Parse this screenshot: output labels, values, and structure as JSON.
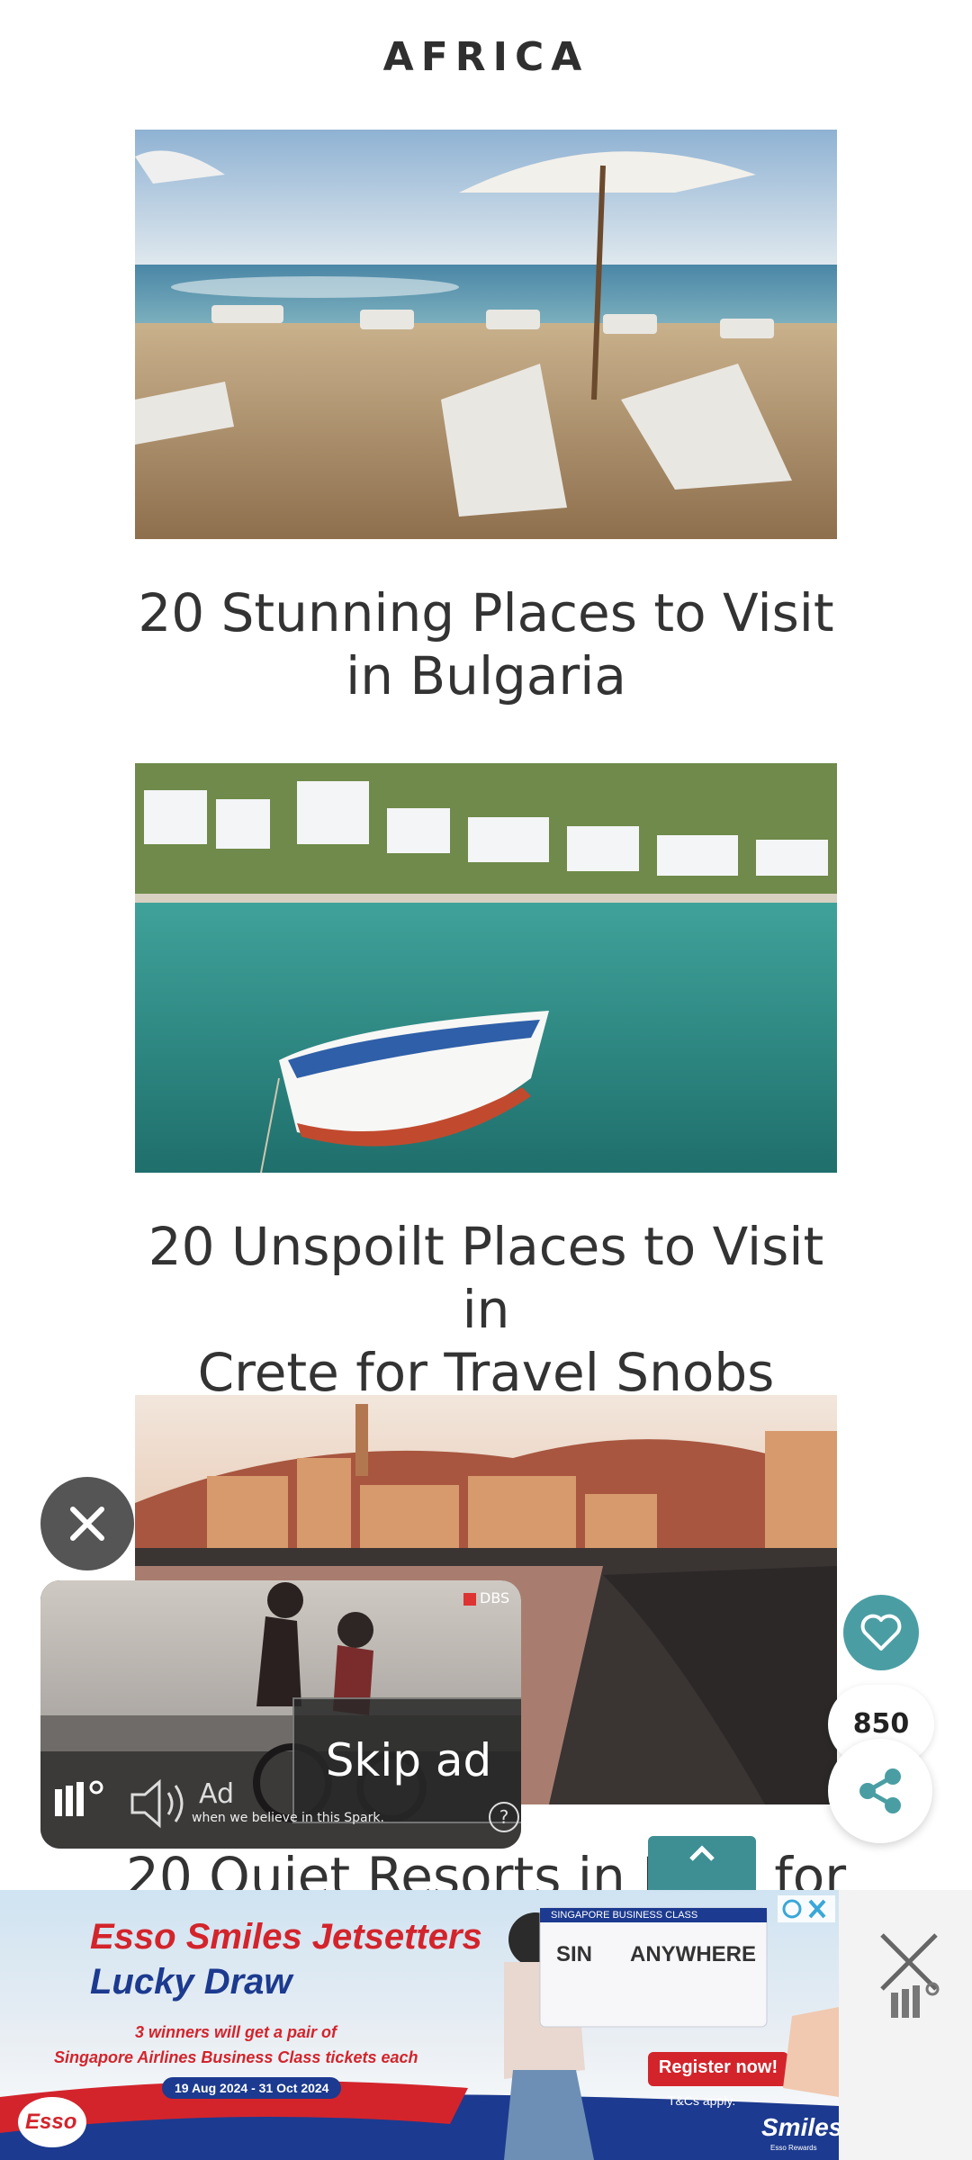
{
  "section": {
    "title": "AFRICA"
  },
  "articles": [
    {
      "title_line1": "20 Stunning Places to Visit",
      "title_line2": "in Bulgaria"
    },
    {
      "title_line1": "20 Unspoilt Places to Visit in",
      "title_line2": "Crete for Travel Snobs"
    },
    {
      "title_partial": "20 Quiet Resorts in I",
      "title_tail": "for"
    }
  ],
  "video_ad": {
    "skip_label": "Skip ad",
    "ad_label": "Ad",
    "caption": "when we believe in this Spark.",
    "help": "?",
    "tag": "DBS"
  },
  "floating": {
    "like_count": "850"
  },
  "banner_ad": {
    "headline_line1": "Esso Smiles Jetsetters",
    "headline_line2": "Lucky Draw",
    "subtext_line1": "3 winners will get a pair of",
    "subtext_line2": "Singapore Airlines Business Class tickets each",
    "dates": "19 Aug 2024 - 31 Oct 2024",
    "ticket_from": "SIN",
    "ticket_to": "ANYWHERE",
    "ticket_header": "SINGAPORE BUSINESS CLASS",
    "cta": "Register now!",
    "tc": "T&Cs apply.",
    "brand_left": "Esso",
    "brand_right": "Smiles",
    "brand_right_sub": "Esso Rewards"
  },
  "colors": {
    "accent": "#4a9ea3",
    "scroll_top": "#3d8f93"
  }
}
